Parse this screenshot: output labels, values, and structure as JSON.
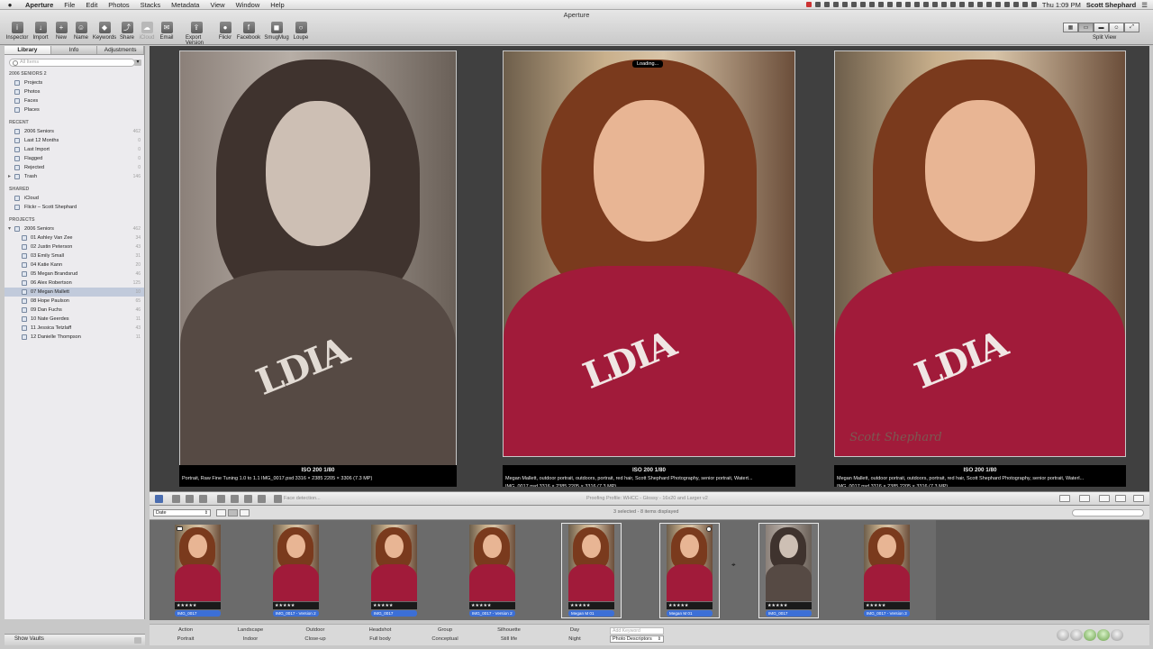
{
  "menubar": {
    "app_name": "Aperture",
    "items": [
      "File",
      "Edit",
      "Photos",
      "Stacks",
      "Metadata",
      "View",
      "Window",
      "Help"
    ],
    "clock": "Thu 1:09 PM",
    "user": "Scott Shephard"
  },
  "window": {
    "title": "Aperture"
  },
  "toolbar": {
    "buttons": [
      {
        "label": "Inspector",
        "icon": "info-icon"
      },
      {
        "label": "Import",
        "icon": "import-icon"
      },
      {
        "label": "New",
        "icon": "plus-icon"
      },
      {
        "label": "Name",
        "icon": "person-icon"
      },
      {
        "label": "Keywords",
        "icon": "tag-icon"
      },
      {
        "label": "Share",
        "icon": "share-icon"
      },
      {
        "label": "iCloud",
        "icon": "cloud-icon"
      },
      {
        "label": "Email",
        "icon": "email-icon"
      },
      {
        "label": "Export Version",
        "icon": "export-icon"
      },
      {
        "label": "Flickr",
        "icon": "flickr-icon"
      },
      {
        "label": "Facebook",
        "icon": "facebook-icon"
      },
      {
        "label": "SmugMug",
        "icon": "smugmug-icon"
      },
      {
        "label": "Loupe",
        "icon": "loupe-icon"
      }
    ],
    "split_view_label": "Split View"
  },
  "sidebar": {
    "tabs": [
      "Library",
      "Info",
      "Adjustments"
    ],
    "search_placeholder": "All Items",
    "library_header": "2006 SENIORS 2",
    "library_items": [
      "Projects",
      "Photos",
      "Faces",
      "Places"
    ],
    "recent_header": "RECENT",
    "recent": [
      {
        "label": "2006 Seniors",
        "count": "462"
      },
      {
        "label": "Last 12 Months",
        "count": "0"
      },
      {
        "label": "Last Import",
        "count": "0"
      },
      {
        "label": "Flagged",
        "count": "0"
      },
      {
        "label": "Rejected",
        "count": "0"
      },
      {
        "label": "Trash",
        "count": "146"
      }
    ],
    "shared_header": "SHARED",
    "shared": [
      "iCloud",
      "Flickr – Scott Shephard"
    ],
    "projects_header": "PROJECTS",
    "projects_root": {
      "label": "2006 Seniors",
      "count": "462"
    },
    "projects": [
      {
        "label": "01 Ashley Van Zee",
        "count": "34"
      },
      {
        "label": "02 Justin Peterson",
        "count": "43"
      },
      {
        "label": "03 Emily Small",
        "count": "31"
      },
      {
        "label": "04 Katie Kann",
        "count": "20"
      },
      {
        "label": "05 Megan Brandsrud",
        "count": "46"
      },
      {
        "label": "06 Alex Robertson",
        "count": "125"
      },
      {
        "label": "07 Megan Mallett",
        "count": "10"
      },
      {
        "label": "08 Hope Paulson",
        "count": "65"
      },
      {
        "label": "09 Dan Fuchs",
        "count": "46"
      },
      {
        "label": "10 Nate Geerdes",
        "count": "11"
      },
      {
        "label": "11 Jessica Tetzlaff",
        "count": "43"
      },
      {
        "label": "12 Danielle Thompson",
        "count": "11"
      }
    ],
    "selected_project_index": 6,
    "show_vaults": "Show Vaults"
  },
  "viewer": {
    "loading": "Loading...",
    "photos": [
      {
        "tone": "sepia",
        "iso": "ISO 200   1/80",
        "line1": "Portrait, Raw Fine Tuning 1.0 to 1.1   IMG_0017.psd   3316 × 2385   2205 × 3306 (7.3 MP)",
        "line2": ""
      },
      {
        "tone": "color",
        "iso": "ISO 200   1/80",
        "line1": "Megan Mallett, outdoor portrait, outdoors, portrait, red hair, Scott Shephard Photography, senior portrait, Watert...",
        "line2": "IMG_0017.psd   3316 × 2385   2205 × 3316 (7.3 MP)"
      },
      {
        "tone": "color",
        "iso": "ISO 200   1/80",
        "line1": "Megan Mallett, outdoor portrait, outdoors, portrait, red hair, Scott Shephard Photography, senior portrait, Waterl...",
        "line2": "IMG_0017.psd   3316 × 2385   2205 × 3316 (7.3 MP)"
      }
    ],
    "signature": "Scott Shephard"
  },
  "toolstrip": {
    "face_detection": "Face detection...",
    "proofing_profile": "Proofing Profile: WHCC - Glossy - 16x20 and Larger v2"
  },
  "browser": {
    "sort": "Date",
    "selection_text": "3 selected - 8 items displayed",
    "thumbs": [
      {
        "name": "IMG_0017",
        "stars": "★★★★★",
        "tone": "color",
        "stack": true,
        "selected": false
      },
      {
        "name": "IMG_0017 - Version 2",
        "stars": "★★★★★",
        "tone": "color",
        "stack": false,
        "selected": false
      },
      {
        "name": "IMG_0017",
        "stars": "★★★★★",
        "tone": "color",
        "stack": false,
        "selected": false
      },
      {
        "name": "IMG_0017 - Version 2",
        "stars": "★★★★★",
        "tone": "color",
        "stack": false,
        "selected": false
      },
      {
        "name": "Megan M 01",
        "stars": "★★★★★",
        "tone": "color",
        "stack": false,
        "selected": true
      },
      {
        "name": "Megan M 01",
        "stars": "★★★★★",
        "tone": "color",
        "stack": false,
        "selected": true,
        "badge": true
      },
      {
        "name": "IMG_0017",
        "stars": "★★★★★",
        "tone": "sepia",
        "stack": false,
        "selected": true
      },
      {
        "name": "IMG_0017 - Version 3",
        "stars": "★★★★★",
        "tone": "color",
        "stack": false,
        "selected": false
      }
    ]
  },
  "keywords": {
    "row1": [
      "Action",
      "Landscape",
      "Outdoor",
      "Headshot",
      "Group",
      "Silhouette",
      "Day"
    ],
    "row2": [
      "Portrait",
      "Indoor",
      "Close-up",
      "Full body",
      "Conceptual",
      "Still life",
      "Night"
    ],
    "add_placeholder": "Add Keyword",
    "preset": "Photo Descriptors"
  },
  "colors": {
    "selection_blue": "#3c6fd6",
    "viewer_bg": "#404040",
    "hoodie": "#a11b3a",
    "sepia": "#6e6058"
  }
}
